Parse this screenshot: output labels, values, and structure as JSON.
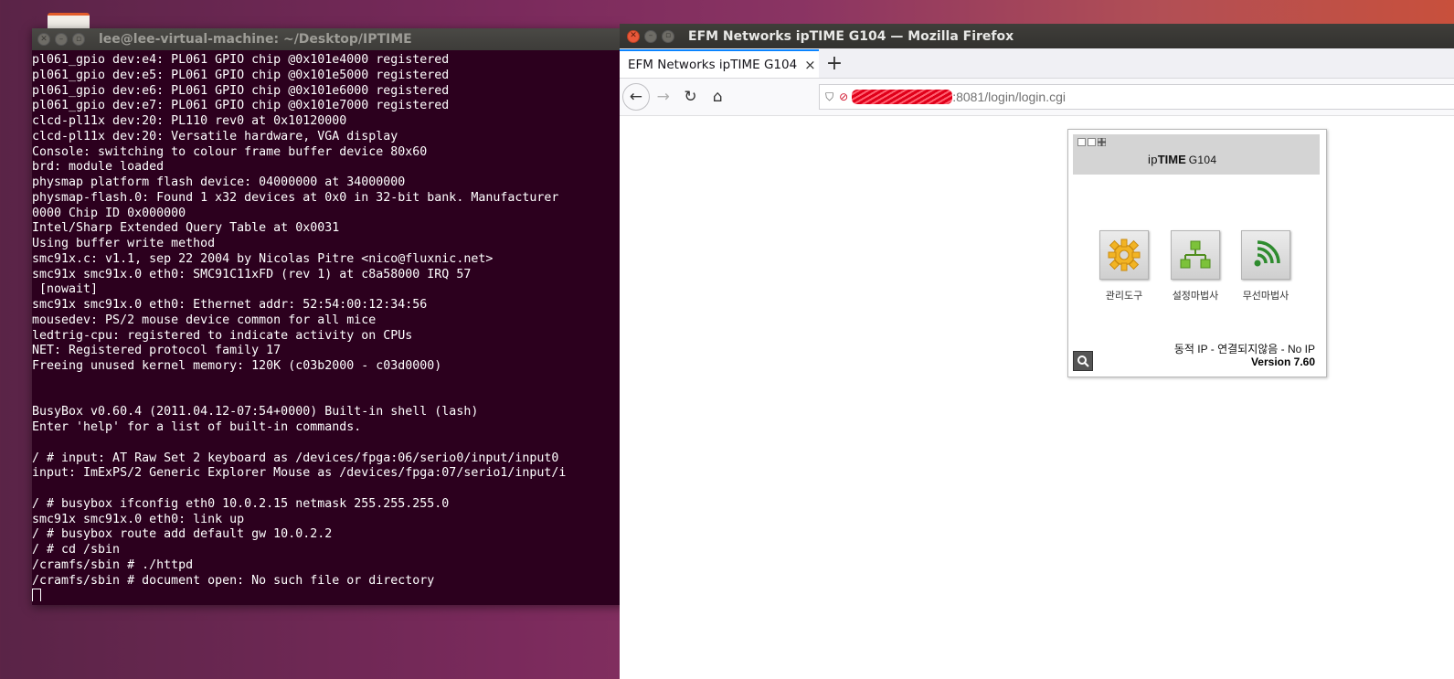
{
  "terminal": {
    "title": "lee@lee-virtual-machine: ~/Desktop/IPTIME",
    "lines": [
      "pl061_gpio dev:e4: PL061 GPIO chip @0x101e4000 registered",
      "pl061_gpio dev:e5: PL061 GPIO chip @0x101e5000 registered",
      "pl061_gpio dev:e6: PL061 GPIO chip @0x101e6000 registered",
      "pl061_gpio dev:e7: PL061 GPIO chip @0x101e7000 registered",
      "clcd-pl11x dev:20: PL110 rev0 at 0x10120000",
      "clcd-pl11x dev:20: Versatile hardware, VGA display",
      "Console: switching to colour frame buffer device 80x60",
      "brd: module loaded",
      "physmap platform flash device: 04000000 at 34000000",
      "physmap-flash.0: Found 1 x32 devices at 0x0 in 32-bit bank. Manufacturer",
      "0000 Chip ID 0x000000",
      "Intel/Sharp Extended Query Table at 0x0031",
      "Using buffer write method",
      "smc91x.c: v1.1, sep 22 2004 by Nicolas Pitre <nico@fluxnic.net>",
      "smc91x smc91x.0 eth0: SMC91C11xFD (rev 1) at c8a58000 IRQ 57",
      " [nowait]",
      "smc91x smc91x.0 eth0: Ethernet addr: 52:54:00:12:34:56",
      "mousedev: PS/2 mouse device common for all mice",
      "ledtrig-cpu: registered to indicate activity on CPUs",
      "NET: Registered protocol family 17",
      "Freeing unused kernel memory: 120K (c03b2000 - c03d0000)",
      "",
      "",
      "BusyBox v0.60.4 (2011.04.12-07:54+0000) Built-in shell (lash)",
      "Enter 'help' for a list of built-in commands.",
      "",
      "/ # input: AT Raw Set 2 keyboard as /devices/fpga:06/serio0/input/input0",
      "input: ImExPS/2 Generic Explorer Mouse as /devices/fpga:07/serio1/input/i",
      "",
      "/ # busybox ifconfig eth0 10.0.2.15 netmask 255.255.255.0",
      "smc91x smc91x.0 eth0: link up",
      "/ # busybox route add default gw 10.0.2.2",
      "/ # cd /sbin",
      "/cramfs/sbin # ./httpd",
      "/cramfs/sbin # document open: No such file or directory"
    ]
  },
  "firefox": {
    "window_title": "EFM Networks ipTIME G104 — Mozilla Firefox",
    "tab_label": "EFM Networks ipTIME G104",
    "tab_close": "×",
    "new_tab": "+",
    "url_visible": ":8081/login/login.cgi"
  },
  "router": {
    "brand_prefix": "ip",
    "brand_bold": "TIME",
    "model": "G104",
    "tools": [
      {
        "label": "관리도구"
      },
      {
        "label": "설정마법사"
      },
      {
        "label": "무선마법사"
      }
    ],
    "status": "동적 IP - 연결되지않음 - No IP",
    "version": "Version 7.60"
  },
  "colors": {
    "terminal_bg": "#2c001e",
    "close_button": "#e9583a",
    "gear": "#f2b424",
    "wizard": "#7cc23a",
    "wireless": "#2e8b2e"
  }
}
